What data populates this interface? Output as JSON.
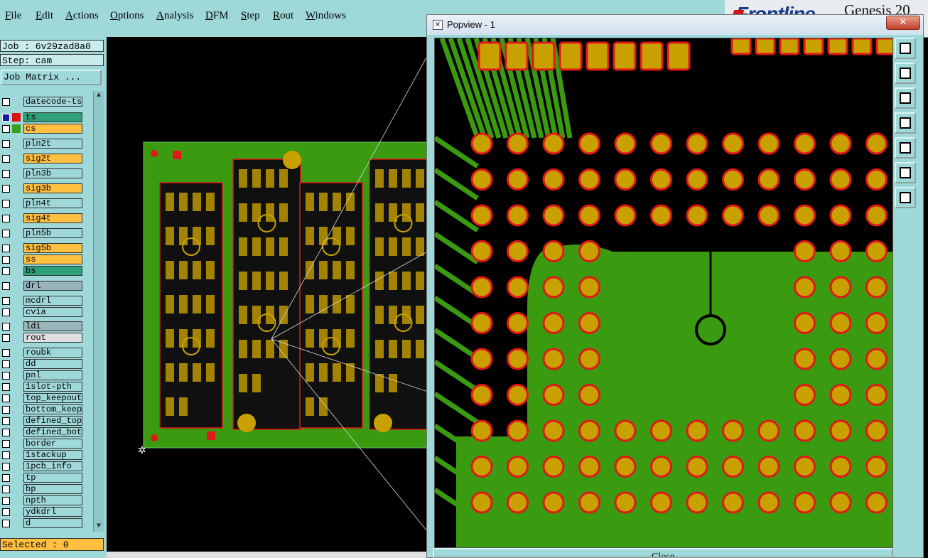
{
  "menu": [
    "File",
    "Edit",
    "Actions",
    "Options",
    "Analysis",
    "DFM",
    "Step",
    "Rout",
    "Windows"
  ],
  "brand": {
    "logo_text": "Frontline",
    "product_text": "Genesis 20"
  },
  "job": {
    "label": "Job : 6v29zad8a0",
    "step": "Step: cam"
  },
  "job_matrix_label": "Job Matrix ...",
  "layers": [
    {
      "name": "datecode-ts",
      "color": "#9fd8d8",
      "swatch": ""
    },
    {
      "name": "ts",
      "color": "#2ea07a",
      "swatch": "#e01010",
      "affected": true
    },
    {
      "name": "cs",
      "color": "#ffbf40",
      "swatch": "#3aa01a"
    },
    {
      "name": "pln2t",
      "color": "#9fd8d8",
      "swatch": ""
    },
    {
      "name": "sig2t",
      "color": "#ffbf40",
      "swatch": ""
    },
    {
      "name": "pln3b",
      "color": "#9fd8d8",
      "swatch": ""
    },
    {
      "name": "sig3b",
      "color": "#ffbf40",
      "swatch": ""
    },
    {
      "name": "pln4t",
      "color": "#9fd8d8",
      "swatch": ""
    },
    {
      "name": "sig4t",
      "color": "#ffbf40",
      "swatch": ""
    },
    {
      "name": "pln5b",
      "color": "#9fd8d8",
      "swatch": ""
    },
    {
      "name": "sig5b",
      "color": "#ffbf40",
      "swatch": ""
    },
    {
      "name": "ss",
      "color": "#ffbf40",
      "swatch": ""
    },
    {
      "name": "bs",
      "color": "#2ea07a",
      "swatch": ""
    },
    {
      "name": "drl",
      "color": "#9ab4bc",
      "swatch": ""
    },
    {
      "name": "mcdrl",
      "color": "#9fd8d8",
      "swatch": ""
    },
    {
      "name": "cvia",
      "color": "#9fd8d8",
      "swatch": ""
    },
    {
      "name": "ldi",
      "color": "#9ab4bc",
      "swatch": ""
    },
    {
      "name": "rout",
      "color": "#e0e0e0",
      "swatch": ""
    },
    {
      "name": "roubk",
      "color": "#9fd8d8",
      "swatch": ""
    },
    {
      "name": "dd",
      "color": "#9fd8d8",
      "swatch": ""
    },
    {
      "name": "pnl",
      "color": "#9fd8d8",
      "swatch": ""
    },
    {
      "name": "1slot-pth",
      "color": "#9fd8d8",
      "swatch": ""
    },
    {
      "name": "top_keepout",
      "color": "#9fd8d8",
      "swatch": ""
    },
    {
      "name": "bottom_keepo",
      "color": "#9fd8d8",
      "swatch": ""
    },
    {
      "name": "defined_topm",
      "color": "#9fd8d8",
      "swatch": ""
    },
    {
      "name": "defined_bott",
      "color": "#9fd8d8",
      "swatch": ""
    },
    {
      "name": "border",
      "color": "#9fd8d8",
      "swatch": ""
    },
    {
      "name": "1stackup",
      "color": "#9fd8d8",
      "swatch": ""
    },
    {
      "name": "1pcb_info",
      "color": "#9fd8d8",
      "swatch": ""
    },
    {
      "name": "tp",
      "color": "#9fd8d8",
      "swatch": ""
    },
    {
      "name": "bp",
      "color": "#9fd8d8",
      "swatch": ""
    },
    {
      "name": "npth",
      "color": "#9fd8d8",
      "swatch": ""
    },
    {
      "name": "ydkdrl",
      "color": "#9fd8d8",
      "swatch": ""
    },
    {
      "name": "d",
      "color": "#9fd8d8",
      "swatch": ""
    }
  ],
  "selected_label": "Selected : 0",
  "popview": {
    "title": "Popview - 1",
    "close_glyph": "✕",
    "close_label": "Close"
  },
  "colors": {
    "board_green": "#3a9a10",
    "pad_orange": "#c8a000",
    "pad_red": "#e01818",
    "pad_ring": "#d02010"
  },
  "icons": [
    "zoom-fit-icon",
    "zoom-in-icon",
    "zoom-out-icon",
    "pan-left-icon",
    "pan-right-icon",
    "expand-icon",
    "contract-icon"
  ]
}
